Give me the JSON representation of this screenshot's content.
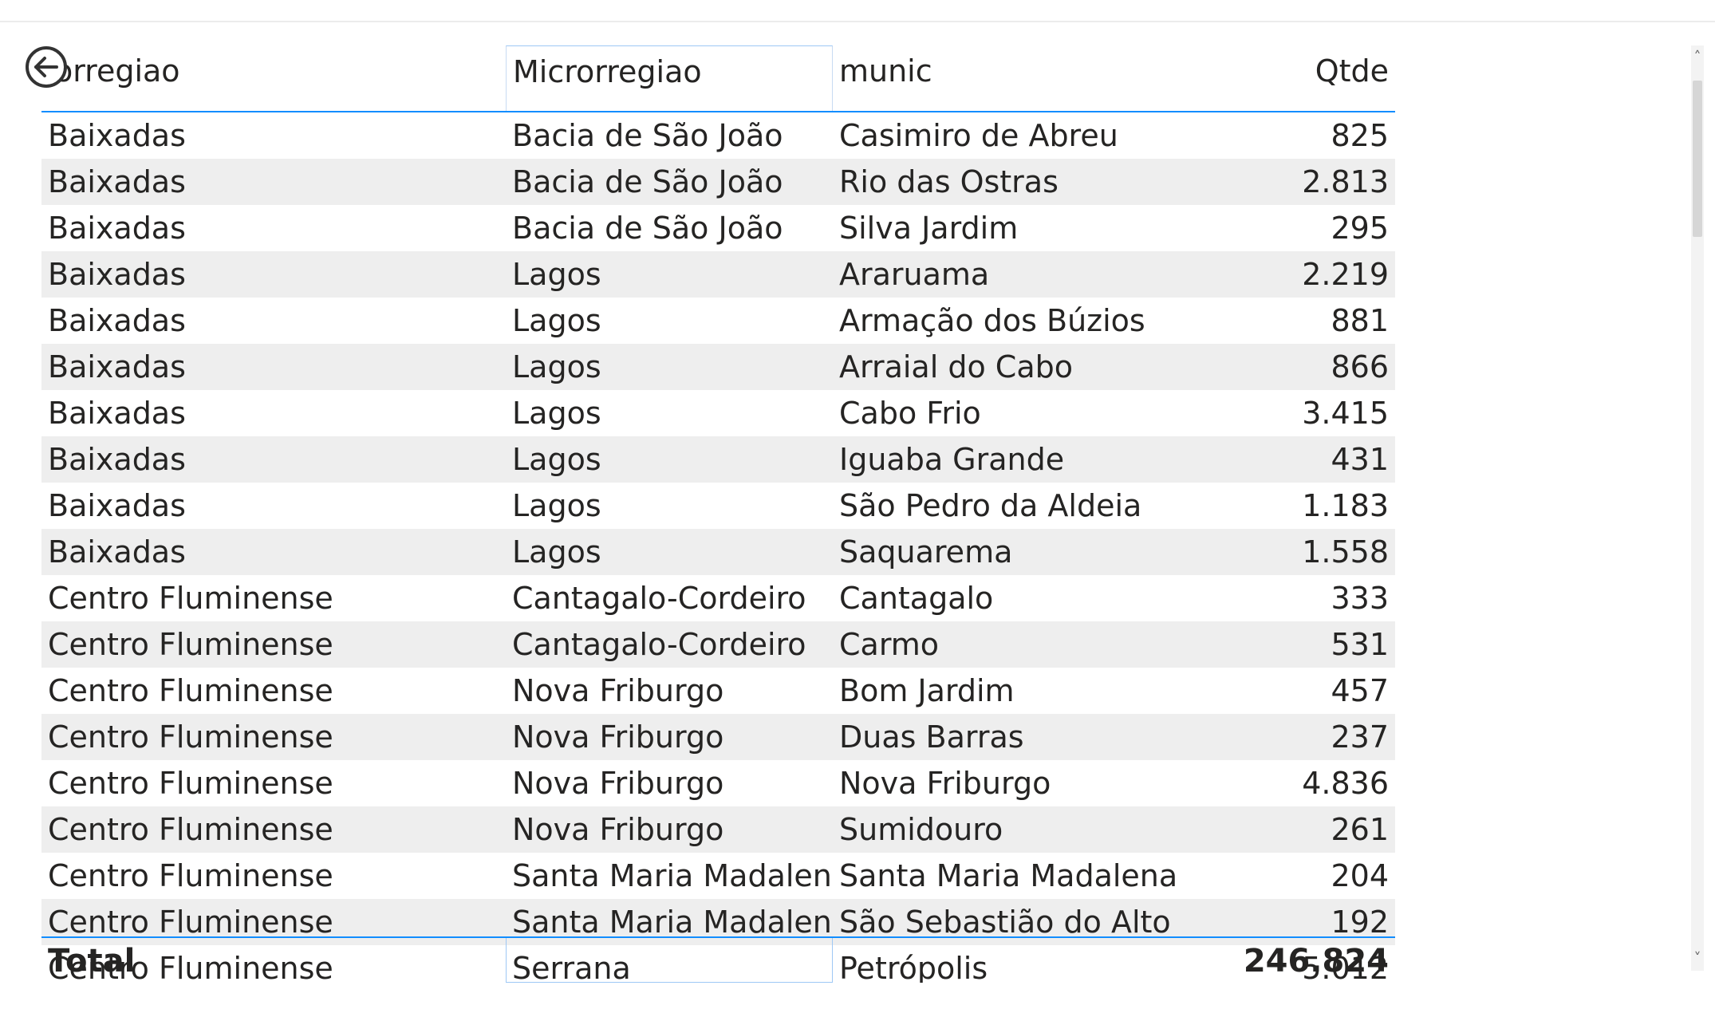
{
  "table": {
    "columns": [
      "Mesorregiao",
      "Microrregiao",
      "munic",
      "Qtde"
    ],
    "rows": [
      [
        "Baixadas",
        "Bacia de São João",
        "Casimiro de Abreu",
        "825"
      ],
      [
        "Baixadas",
        "Bacia de São João",
        "Rio das Ostras",
        "2.813"
      ],
      [
        "Baixadas",
        "Bacia de São João",
        "Silva Jardim",
        "295"
      ],
      [
        "Baixadas",
        "Lagos",
        "Araruama",
        "2.219"
      ],
      [
        "Baixadas",
        "Lagos",
        "Armação dos Búzios",
        "881"
      ],
      [
        "Baixadas",
        "Lagos",
        "Arraial do Cabo",
        "866"
      ],
      [
        "Baixadas",
        "Lagos",
        "Cabo Frio",
        "3.415"
      ],
      [
        "Baixadas",
        "Lagos",
        "Iguaba Grande",
        "431"
      ],
      [
        "Baixadas",
        "Lagos",
        "São Pedro da Aldeia",
        "1.183"
      ],
      [
        "Baixadas",
        "Lagos",
        "Saquarema",
        "1.558"
      ],
      [
        "Centro Fluminense",
        "Cantagalo-Cordeiro",
        "Cantagalo",
        "333"
      ],
      [
        "Centro Fluminense",
        "Cantagalo-Cordeiro",
        "Carmo",
        "531"
      ],
      [
        "Centro Fluminense",
        "Nova Friburgo",
        "Bom Jardim",
        "457"
      ],
      [
        "Centro Fluminense",
        "Nova Friburgo",
        "Duas Barras",
        "237"
      ],
      [
        "Centro Fluminense",
        "Nova Friburgo",
        "Nova Friburgo",
        "4.836"
      ],
      [
        "Centro Fluminense",
        "Nova Friburgo",
        "Sumidouro",
        "261"
      ],
      [
        "Centro Fluminense",
        "Santa Maria Madalena",
        "Santa Maria Madalena",
        "204"
      ],
      [
        "Centro Fluminense",
        "Santa Maria Madalena",
        "São Sebastião do Alto",
        "192"
      ],
      [
        "Centro Fluminense",
        "Serrana",
        "Petrópolis",
        "5.012"
      ]
    ],
    "total": {
      "label": "Total",
      "value": "246.824"
    }
  },
  "icons": {
    "back": "back-arrow-circle-icon",
    "scroll_up": "chevron-up-icon",
    "scroll_down": "chevron-down-icon"
  },
  "scrollbar": {
    "up_glyph": "˄",
    "down_glyph": "˅"
  },
  "colors": {
    "accent": "#118dff",
    "row_alt": "#eeeeee",
    "text": "#252423"
  }
}
